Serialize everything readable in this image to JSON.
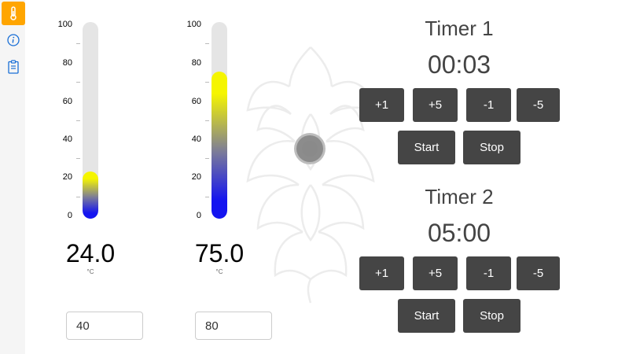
{
  "sidebar": {
    "items": [
      {
        "icon": "thermometer-icon",
        "active": true
      },
      {
        "icon": "info-icon",
        "active": false
      },
      {
        "icon": "clipboard-icon",
        "active": false
      }
    ],
    "accent": "#ffa500"
  },
  "thermometers": [
    {
      "scale": [
        "100",
        "80",
        "60",
        "40",
        "20",
        "0"
      ],
      "fill_percent": 24,
      "reading": "24.0",
      "unit": "°C",
      "setpoint": "40"
    },
    {
      "scale": [
        "100",
        "80",
        "60",
        "40",
        "20",
        "0"
      ],
      "fill_percent": 75,
      "reading": "75.0",
      "unit": "°C",
      "setpoint": "80"
    }
  ],
  "timers": [
    {
      "title": "Timer 1",
      "value": "00:03",
      "buttons": {
        "plus1": "+1",
        "plus5": "+5",
        "minus1": "-1",
        "minus5": "-5",
        "start": "Start",
        "stop": "Stop"
      }
    },
    {
      "title": "Timer 2",
      "value": "05:00",
      "buttons": {
        "plus1": "+1",
        "plus5": "+5",
        "minus1": "-1",
        "minus5": "-5",
        "start": "Start",
        "stop": "Stop"
      }
    }
  ],
  "colors": {
    "button_bg": "#454545",
    "fill_low": "#1414f0",
    "fill_high": "#f5f500",
    "tube_bg": "#e5e5e5"
  }
}
